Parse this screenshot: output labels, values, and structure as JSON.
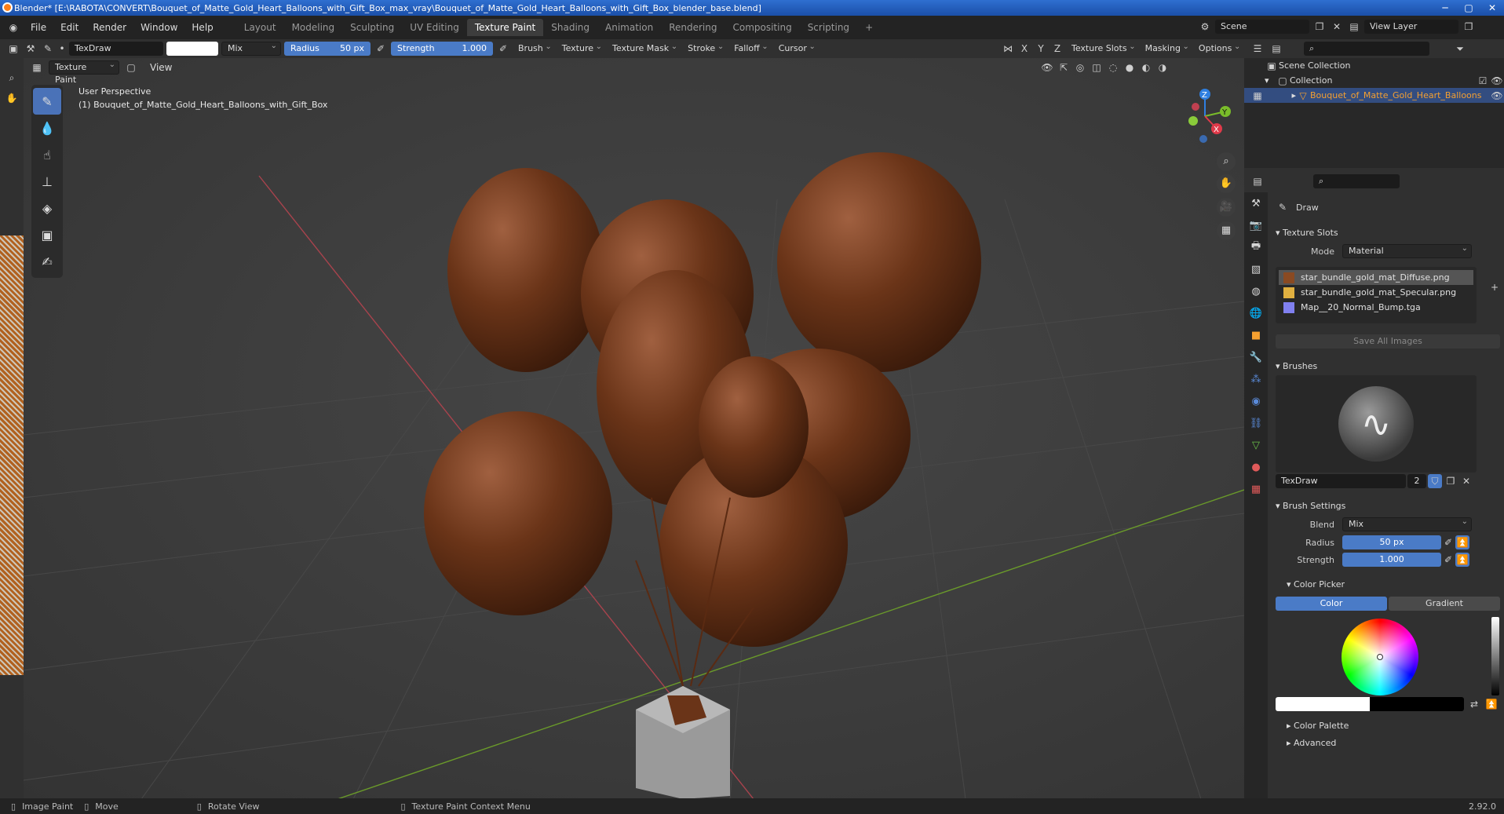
{
  "window": {
    "title": "Blender* [E:\\RABOTA\\CONVERT\\Bouquet_of_Matte_Gold_Heart_Balloons_with_Gift_Box_max_vray\\Bouquet_of_Matte_Gold_Heart_Balloons_with_Gift_Box_blender_base.blend]",
    "minimize": "─",
    "maximize": "▢",
    "close": "✕"
  },
  "menu": {
    "items": [
      "File",
      "Edit",
      "Render",
      "Window",
      "Help"
    ],
    "workspaces": [
      "Layout",
      "Modeling",
      "Sculpting",
      "UV Editing",
      "Texture Paint",
      "Shading",
      "Animation",
      "Rendering",
      "Compositing",
      "Scripting"
    ],
    "active_workspace": "Texture Paint",
    "add": "+",
    "scene": "Scene",
    "view_layer": "View Layer"
  },
  "tool_header": {
    "brush_name": "TexDraw",
    "blend": "Mix",
    "radius_label": "Radius",
    "radius_value": "50 px",
    "strength_label": "Strength",
    "strength_value": "1.000",
    "menus": [
      "Brush",
      "Texture",
      "Texture Mask",
      "Stroke",
      "Falloff",
      "Cursor"
    ],
    "axes": [
      "X",
      "Y",
      "Z"
    ],
    "right_menus": [
      "Texture Slots",
      "Masking",
      "Options"
    ]
  },
  "viewport_header": {
    "mode": "Texture Paint",
    "view": "View"
  },
  "viewport": {
    "perspective": "User Perspective",
    "object_label": "(1) Bouquet_of_Matte_Gold_Heart_Balloons_with_Gift_Box",
    "gizmo": {
      "x": "X",
      "y": "Y",
      "z": "Z"
    }
  },
  "outliner": {
    "scene_collection": "Scene Collection",
    "collection": "Collection",
    "object": "Bouquet_of_Matte_Gold_Heart_Balloons"
  },
  "properties": {
    "tool_name": "Draw",
    "texture_slots_title": "Texture Slots",
    "mode_label": "Mode",
    "mode_value": "Material",
    "slots": [
      {
        "name": "star_bundle_gold_mat_Diffuse.png",
        "color": "#8a4a22",
        "selected": true
      },
      {
        "name": "star_bundle_gold_mat_Specular.png",
        "color": "#e0b040",
        "selected": false
      },
      {
        "name": "Map__20_Normal_Bump.tga",
        "color": "#8080f0",
        "selected": false
      }
    ],
    "save_all": "Save All Images",
    "brushes_title": "Brushes",
    "brush_name": "TexDraw",
    "brush_users": "2",
    "brush_settings_title": "Brush Settings",
    "blend_label": "Blend",
    "blend_value": "Mix",
    "radius_label": "Radius",
    "radius_value": "50 px",
    "strength_label": "Strength",
    "strength_value": "1.000",
    "color_picker_title": "Color Picker",
    "color_tab": "Color",
    "gradient_tab": "Gradient",
    "color_palette_title": "Color Palette",
    "advanced_title": "Advanced"
  },
  "statusbar": {
    "items": [
      "Image Paint",
      "Move",
      "Rotate View",
      "Texture Paint Context Menu"
    ],
    "version": "2.92.0"
  },
  "colors": {
    "accent": "#4a7bc7",
    "balloon": "#6a3418",
    "box": "#9a9a9a"
  }
}
